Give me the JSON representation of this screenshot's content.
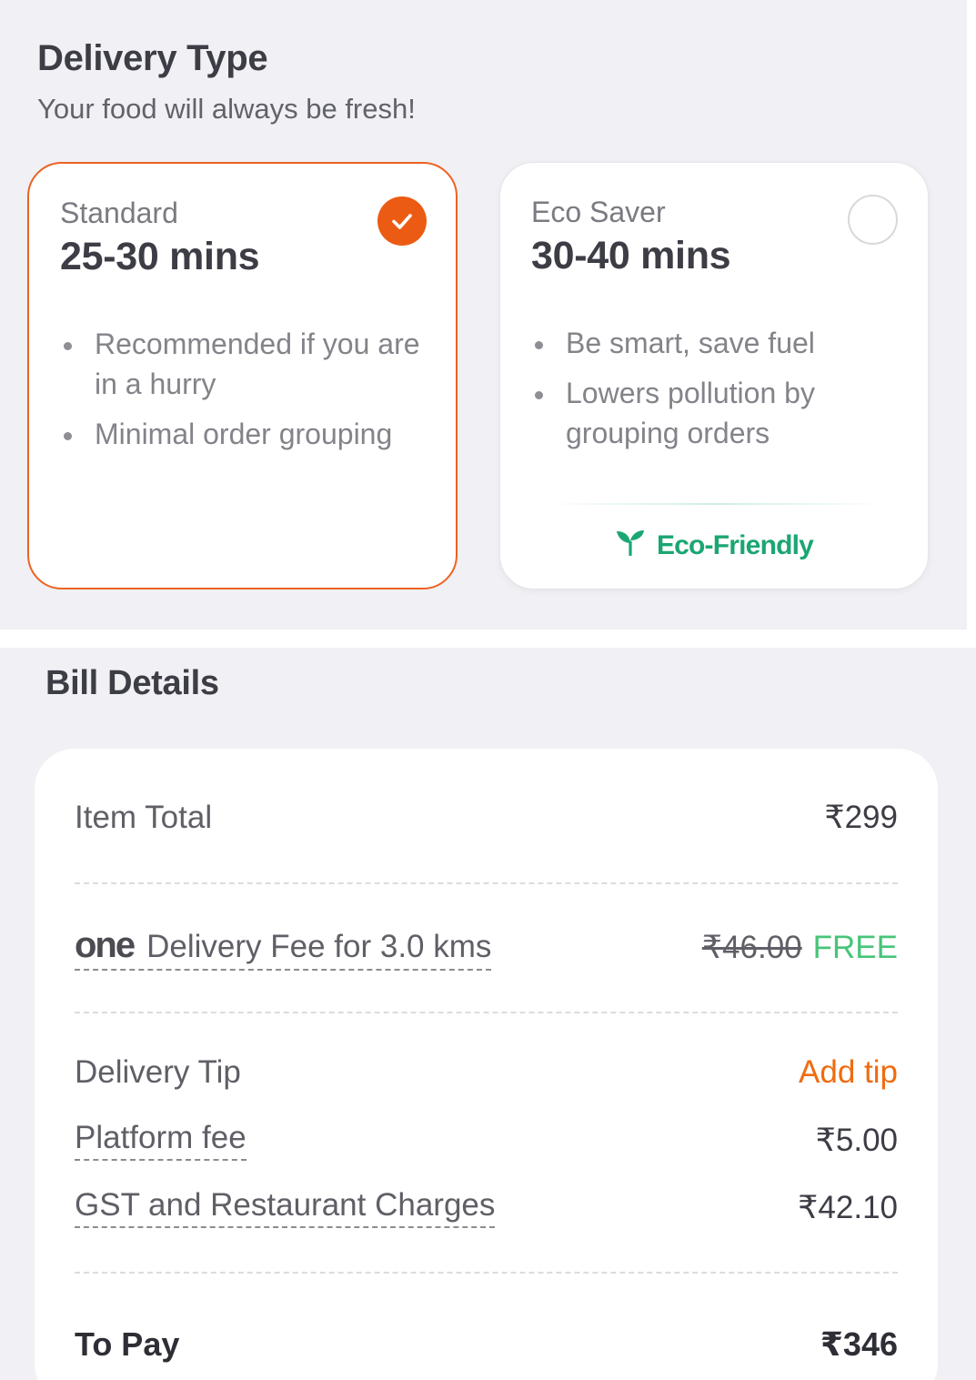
{
  "delivery_type": {
    "title": "Delivery Type",
    "subtitle": "Your food will always be fresh!",
    "options": [
      {
        "name": "Standard",
        "time": "25-30 mins",
        "selected": true,
        "bullets": [
          "Recommended if you are in a hurry",
          "Minimal order grouping"
        ]
      },
      {
        "name": "Eco Saver",
        "time": "30-40 mins",
        "selected": false,
        "bullets": [
          "Be smart, save fuel",
          "Lowers pollution by grouping orders"
        ],
        "badge": "Eco-Friendly"
      }
    ]
  },
  "bill": {
    "title": "Bill Details",
    "item_total_label": "Item Total",
    "item_total_value": "₹299",
    "one_logo": "one",
    "delivery_fee_label": "Delivery Fee for 3.0 kms",
    "delivery_fee_original": "₹46.00",
    "delivery_fee_value": "FREE",
    "tip_label": "Delivery Tip",
    "tip_action": "Add tip",
    "platform_fee_label": "Platform fee",
    "platform_fee_value": "₹5.00",
    "gst_label": "GST and Restaurant Charges",
    "gst_value": "₹42.10",
    "to_pay_label": "To Pay",
    "to_pay_value": "₹346"
  },
  "colors": {
    "accent": "#ec5b13",
    "eco_green": "#1ba672",
    "free_green": "#48c479",
    "background": "#f0f0f5"
  }
}
